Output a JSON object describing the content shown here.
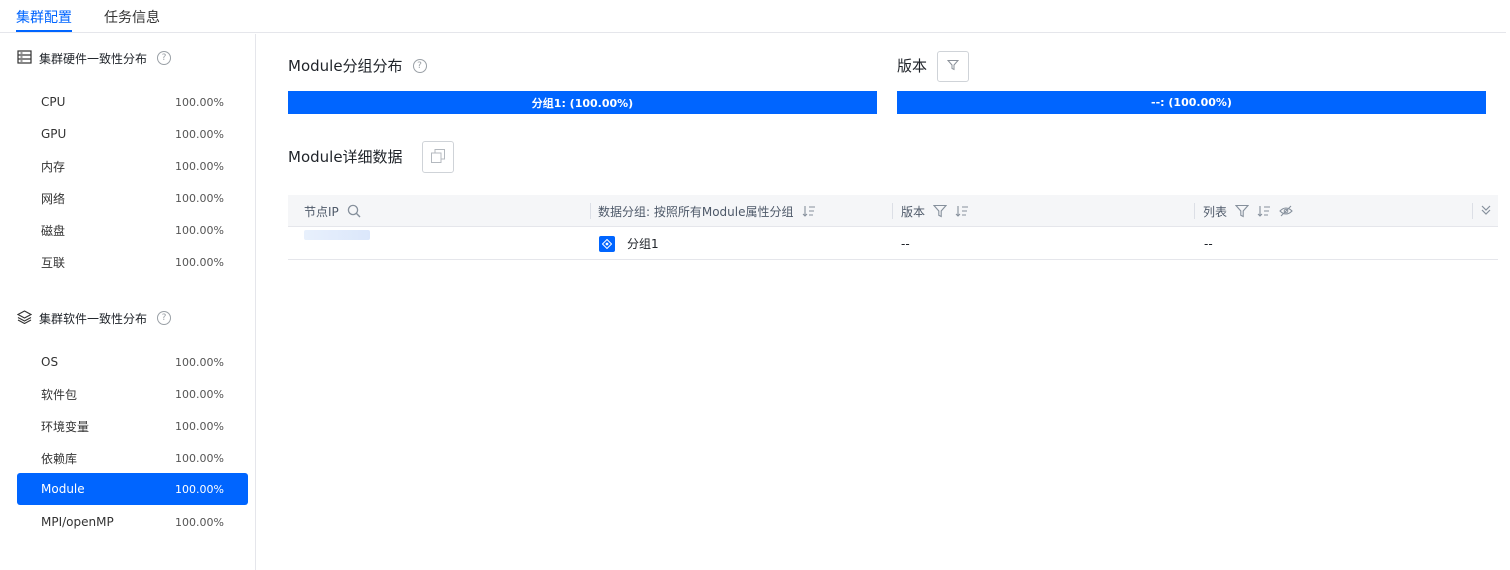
{
  "tabs": [
    {
      "label": "集群配置",
      "active": true
    },
    {
      "label": "任务信息",
      "active": false
    }
  ],
  "sidebar": {
    "hardware": {
      "title": "集群硬件一致性分布",
      "icon": "server-icon",
      "items": [
        {
          "label": "CPU",
          "value": "100.00%"
        },
        {
          "label": "GPU",
          "value": "100.00%"
        },
        {
          "label": "内存",
          "value": "100.00%"
        },
        {
          "label": "网络",
          "value": "100.00%"
        },
        {
          "label": "磁盘",
          "value": "100.00%"
        },
        {
          "label": "互联",
          "value": "100.00%"
        }
      ]
    },
    "software": {
      "title": "集群软件一致性分布",
      "icon": "layers-icon",
      "items": [
        {
          "label": "OS",
          "value": "100.00%"
        },
        {
          "label": "软件包",
          "value": "100.00%"
        },
        {
          "label": "环境变量",
          "value": "100.00%"
        },
        {
          "label": "依赖库",
          "value": "100.00%"
        },
        {
          "label": "Module",
          "value": "100.00%",
          "active": true
        },
        {
          "label": "MPI/openMP",
          "value": "100.00%"
        }
      ]
    }
  },
  "main": {
    "group_dist": {
      "title": "Module分组分布",
      "bar_label": "分组1: (100.00%)",
      "fraction": 1.0
    },
    "version_dist": {
      "title": "版本",
      "bar_label": "--: (100.00%)",
      "fraction": 1.0
    },
    "detail": {
      "title": "Module详细数据"
    },
    "table": {
      "columns": [
        {
          "label": "节点IP"
        },
        {
          "label": "数据分组: 按照所有Module属性分组"
        },
        {
          "label": "版本"
        },
        {
          "label": "列表"
        }
      ],
      "rows": [
        {
          "ip": "",
          "group": "分组1",
          "version": "--",
          "list": "--"
        }
      ]
    }
  },
  "colors": {
    "accent": "#0065ff",
    "border": "#e5e6eb",
    "header_bg": "#f5f6f8"
  }
}
